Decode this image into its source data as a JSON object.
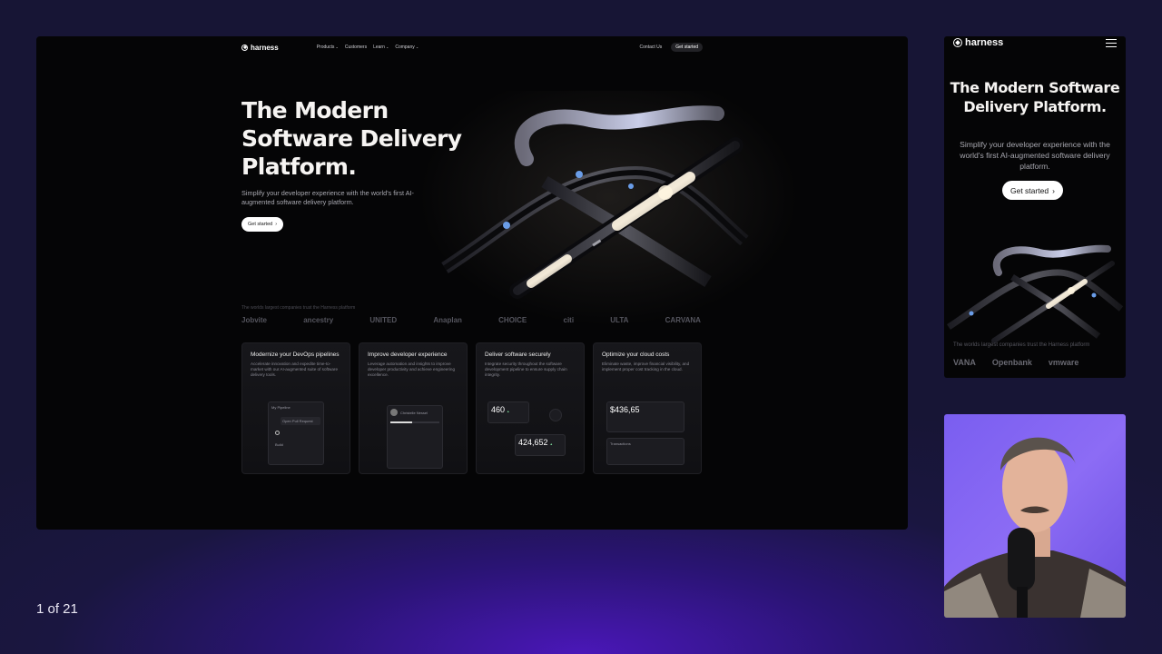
{
  "desktop": {
    "nav": {
      "brand": "harness",
      "links": [
        "Products",
        "Customers",
        "Learn",
        "Company"
      ],
      "contact": "Contact Us",
      "get_started": "Get started"
    },
    "hero": {
      "title": "The Modern Software Delivery Platform.",
      "subtitle": "Simplify your developer experience with the world's first AI-augmented software delivery platform.",
      "cta": "Get started",
      "cta_icon": "chevron-right-icon"
    },
    "trust_line": "The worlds largest companies trust the Harness platform",
    "customer_logos": [
      "Jobvite",
      "ancestry",
      "UNITED",
      "Anaplan",
      "CHOICE",
      "citi",
      "ULTA",
      "CARVANA"
    ],
    "cards": [
      {
        "title": "Modernize your DevOps pipelines",
        "body": "Accelerate innovation and expedite time-to-market with our AI-augmented suite of software delivery tools.",
        "widget": {
          "heading": "My Pipeline",
          "step1": "Open Pull Request",
          "step2": "Build"
        }
      },
      {
        "title": "Improve developer experience",
        "body": "Leverage automation and insights to improve developer productivity and achieve engineering excellence.",
        "widget": {
          "name": "Christelle Nessel"
        }
      },
      {
        "title": "Deliver software securely",
        "body": "Integrate security throughout the software development pipeline to ensure supply chain integrity.",
        "widget": {
          "value1": "460",
          "value2": "424,652"
        }
      },
      {
        "title": "Optimize your cloud costs",
        "body": "Eliminate waste, improve financial visibility, and implement proper cost tracking in the cloud.",
        "widget": {
          "amount": "$436,65",
          "transactions": "Transactions"
        }
      }
    ]
  },
  "mobile": {
    "brand": "harness",
    "menu_icon": "hamburger-menu-icon",
    "title": "The Modern Software Delivery Platform.",
    "subtitle": "Simplify your developer experience with the world's first AI-augmented software delivery platform.",
    "cta": "Get started",
    "trust_line": "The worlds largest companies trust the Harness platform",
    "logos": [
      "VANA",
      "Openbank",
      "vmware"
    ]
  },
  "slide_counter": "1 of 21",
  "colors": {
    "accent": "#4a17b8",
    "page_bg": "#050506"
  }
}
